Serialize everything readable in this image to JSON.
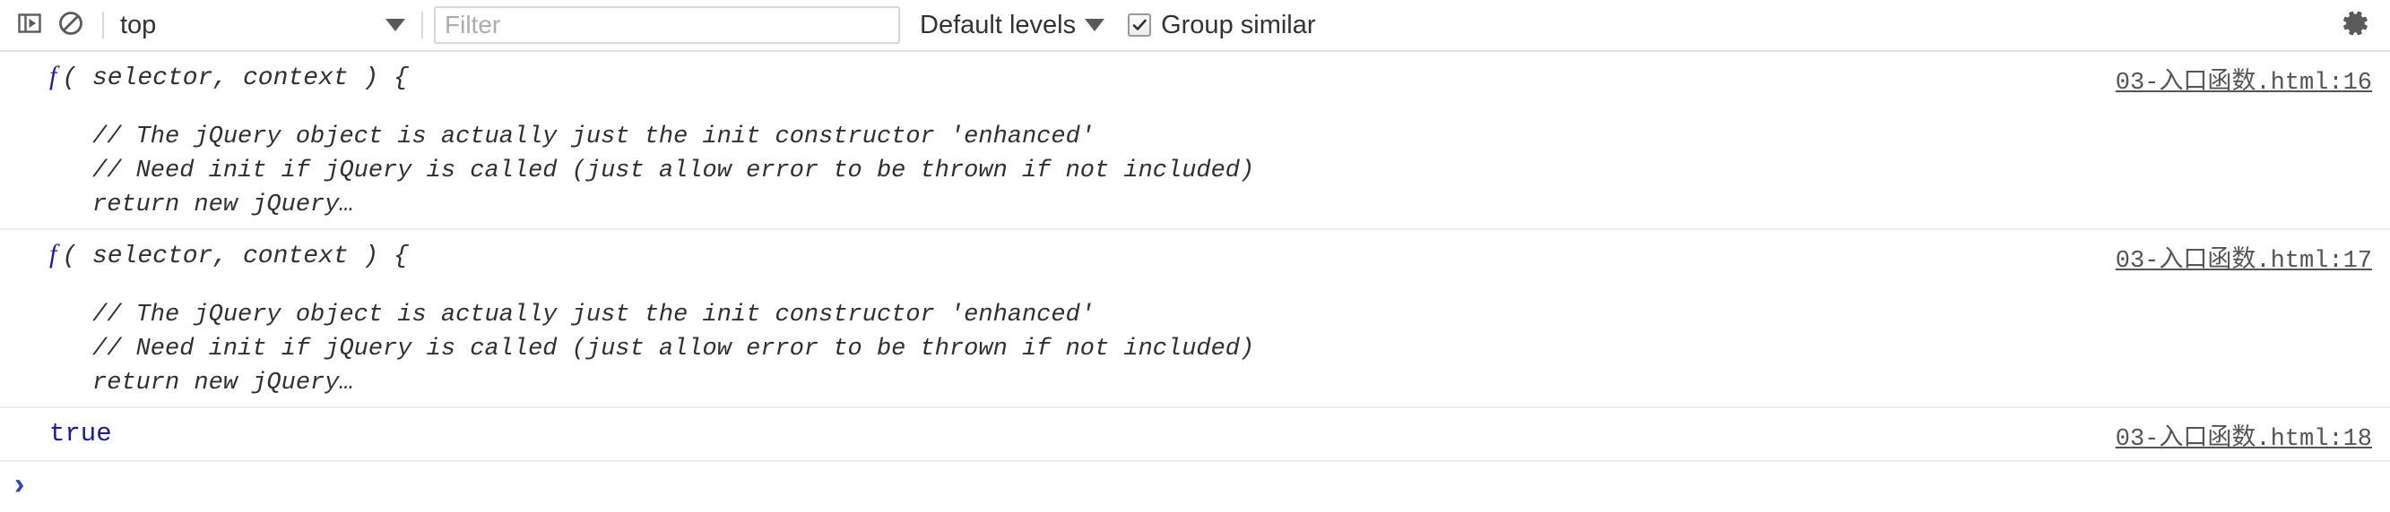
{
  "toolbar": {
    "sidebar_toggle_icon": "console-sidebar-icon",
    "clear_console_icon": "clear-console-icon",
    "context": {
      "selected": "top",
      "caret_icon": "chevron-down-icon"
    },
    "filter": {
      "value": "",
      "placeholder": "Filter"
    },
    "levels": {
      "label": "Default levels",
      "caret_icon": "chevron-down-icon"
    },
    "group_similar": {
      "label": "Group similar",
      "checked": true,
      "check_icon": "checkmark-icon"
    },
    "settings_icon": "gear-icon"
  },
  "console": {
    "entries": [
      {
        "type": "function",
        "fn_marker": "f",
        "signature": "( selector, context ) {",
        "body_lines": [
          "// The jQuery object is actually just the init constructor 'enhanced'",
          "// Need init if jQuery is called (just allow error to be thrown if not included)",
          "return new jQuery…"
        ],
        "source": "03-入口函数.html:16"
      },
      {
        "type": "function",
        "fn_marker": "f",
        "signature": "( selector, context ) {",
        "body_lines": [
          "// The jQuery object is actually just the init constructor 'enhanced'",
          "// Need init if jQuery is called (just allow error to be thrown if not included)",
          "return new jQuery…"
        ],
        "source": "03-入口函数.html:17"
      },
      {
        "type": "value",
        "value": "true",
        "source": "03-入口函数.html:18"
      }
    ],
    "prompt": {
      "arrow": "›",
      "value": ""
    }
  },
  "colors": {
    "fn_blue": "#1a1aa6",
    "prompt_blue": "#2b44c7",
    "text": "#303030",
    "link": "#555555",
    "border": "#ededed",
    "toolbar_border": "#e0e0e0"
  }
}
